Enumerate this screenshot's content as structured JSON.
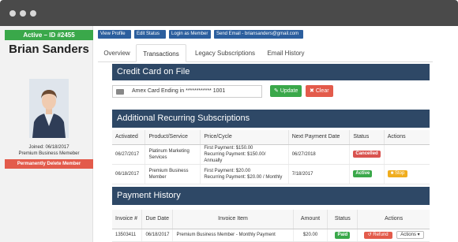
{
  "profile": {
    "status": "Active – ID #2455",
    "name": "Brian Sanders",
    "joined_label": "Joined:",
    "joined_date": "06/18/2017",
    "plan": "Premium Business Memeber",
    "delete_label": "Permanently Delete Member"
  },
  "toolbar": {
    "view_profile": "View Profile",
    "edit_status": "Edit Status",
    "login_as": "Login as Member",
    "send_email": "Send Email - briansanders@gmail.com"
  },
  "tabs": [
    "Overview",
    "Transactions",
    "Legacy Subscriptions",
    "Email History"
  ],
  "credit_card": {
    "title": "Credit Card on File",
    "value": "Amex Card Ending in ************ 1001",
    "update": "Update",
    "clear": "Clear"
  },
  "subscriptions": {
    "title": "Additional Recurring Subscriptions",
    "headers": [
      "Activated",
      "Product/Service",
      "Price/Cycle",
      "Next Payment Date",
      "Status",
      "Actions"
    ],
    "rows": [
      {
        "activated": "06/27/2017",
        "product": "Platinum Marketing Services",
        "price1": "First Payment: $150.00",
        "price2": "Recurring Payment: $150.00/ Annually",
        "next": "06/27/2018",
        "status": "Cancelled",
        "action": ""
      },
      {
        "activated": "06/18/2017",
        "product": "Premium Business Member",
        "price1": "First Payment: $20.00",
        "price2": "Recurring Payment: $20.00 / Monthly",
        "next": "7/18/2017",
        "status": "Active",
        "action": "Stop"
      }
    ]
  },
  "payments": {
    "title": "Payment History",
    "headers": [
      "Invoice #",
      "Due Date",
      "Invoice Item",
      "Amount",
      "Status",
      "Actions"
    ],
    "rows": [
      {
        "invoice": "13503411",
        "due": "06/18/2017",
        "item": "Premium Business Member - Monthly Payment",
        "amount": "$20.00",
        "status": "Paid",
        "refund": "Refund",
        "actions": "Actions"
      }
    ]
  },
  "colors": {
    "section_header": "#2e4866",
    "success": "#3aa84a",
    "danger": "#e35b4b",
    "warning": "#f0ad1e",
    "primary": "#2c5f9e"
  }
}
